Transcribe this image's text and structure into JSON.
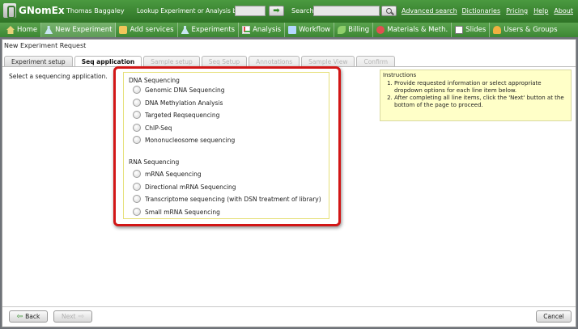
{
  "header": {
    "app_name": "GNomEx",
    "user_name": "Thomas Baggaley",
    "lookup_label": "Lookup Experiment or Analysis by #",
    "lookup_go": "➡",
    "search_label": "Search",
    "advanced_search": "Advanced search",
    "links": [
      "Dictionaries",
      "Pricing",
      "Help",
      "About"
    ]
  },
  "nav": {
    "items": [
      {
        "label": "Home",
        "icon": "home-icon"
      },
      {
        "label": "New Experiment",
        "icon": "flask-icon"
      },
      {
        "label": "Add services",
        "icon": "add-services-icon"
      },
      {
        "label": "Experiments",
        "icon": "flask-icon"
      },
      {
        "label": "Analysis",
        "icon": "chart-icon"
      },
      {
        "label": "Workflow",
        "icon": "workflow-icon"
      },
      {
        "label": "Billing",
        "icon": "billing-icon"
      },
      {
        "label": "Materials & Meth.",
        "icon": "materials-icon"
      },
      {
        "label": "Slides",
        "icon": "slides-icon"
      },
      {
        "label": "Users & Groups",
        "icon": "users-icon"
      }
    ],
    "active_index": 1
  },
  "page": {
    "title": "New Experiment Request",
    "tabs": [
      {
        "label": "Experiment setup",
        "state": "normal"
      },
      {
        "label": "Seq application",
        "state": "active"
      },
      {
        "label": "Sample setup",
        "state": "disabled"
      },
      {
        "label": "Seq Setup",
        "state": "disabled"
      },
      {
        "label": "Annotations",
        "state": "disabled"
      },
      {
        "label": "Sample View",
        "state": "disabled"
      },
      {
        "label": "Confirm",
        "state": "disabled"
      }
    ],
    "prompt": "Select a sequencing application."
  },
  "applications": {
    "dna_title": "DNA Sequencing",
    "dna_options": [
      "Genomic DNA Sequencing",
      "DNA Methylation Analysis",
      "Targeted Reqsequencing",
      "ChIP-Seq",
      "Mononucleosome sequencing"
    ],
    "rna_title": "RNA Sequencing",
    "rna_options": [
      "mRNA Sequencing",
      "Directional mRNA Sequencing",
      "Transcriptome sequencing (with DSN treatment of library)",
      "Small mRNA Sequencing"
    ]
  },
  "instructions": {
    "title": "Instructions",
    "steps": [
      "Provide requested information or select appropriate dropdown options for each line item below.",
      "After completing all line items, click the 'Next' button at the bottom of the page to proceed."
    ]
  },
  "footer": {
    "back_label": "Back",
    "next_label": "Next",
    "cancel_label": "Cancel"
  },
  "colors": {
    "header_green": "#3a8530",
    "highlight_red": "#d21616",
    "instructions_bg": "#ffffc8"
  }
}
